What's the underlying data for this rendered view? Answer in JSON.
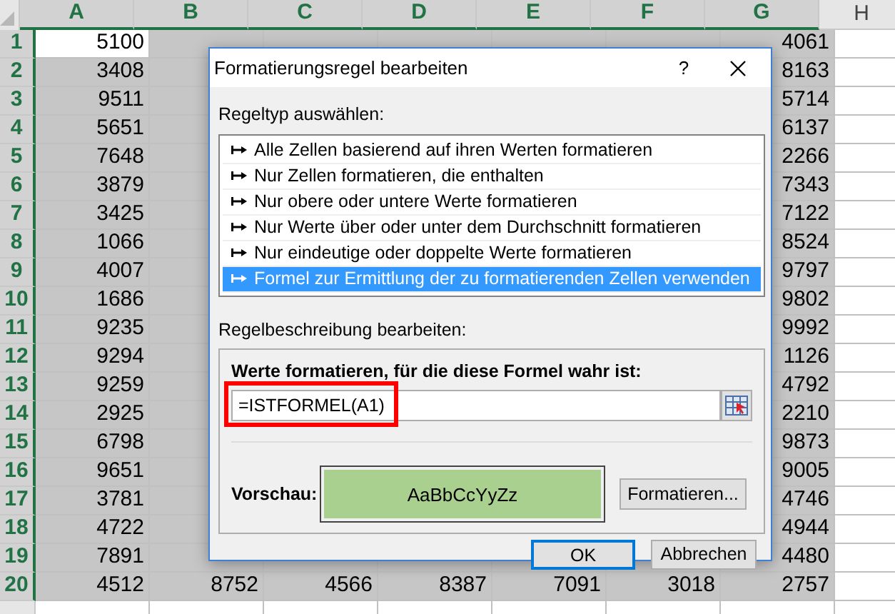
{
  "sheet": {
    "columns": [
      {
        "label": "A",
        "selected": true
      },
      {
        "label": "B",
        "selected": true
      },
      {
        "label": "C",
        "selected": true
      },
      {
        "label": "D",
        "selected": true
      },
      {
        "label": "E",
        "selected": true
      },
      {
        "label": "F",
        "selected": true
      },
      {
        "label": "G",
        "selected": true
      },
      {
        "label": "H",
        "selected": false
      }
    ],
    "rows": [
      {
        "header": "1",
        "selected": true,
        "cells": [
          "5100",
          null,
          null,
          null,
          null,
          null,
          "4061"
        ]
      },
      {
        "header": "2",
        "selected": true,
        "cells": [
          "3408",
          null,
          null,
          null,
          null,
          null,
          "8163"
        ]
      },
      {
        "header": "3",
        "selected": true,
        "cells": [
          "9511",
          null,
          null,
          null,
          null,
          null,
          "5714"
        ]
      },
      {
        "header": "4",
        "selected": true,
        "cells": [
          "5651",
          null,
          null,
          null,
          null,
          null,
          "6137"
        ]
      },
      {
        "header": "5",
        "selected": true,
        "cells": [
          "7648",
          null,
          null,
          null,
          null,
          null,
          "2266"
        ]
      },
      {
        "header": "6",
        "selected": true,
        "cells": [
          "3879",
          null,
          null,
          null,
          null,
          null,
          "7343"
        ]
      },
      {
        "header": "7",
        "selected": true,
        "cells": [
          "3425",
          null,
          null,
          null,
          null,
          null,
          "7122"
        ]
      },
      {
        "header": "8",
        "selected": true,
        "cells": [
          "1066",
          null,
          null,
          null,
          null,
          null,
          "8524"
        ]
      },
      {
        "header": "9",
        "selected": true,
        "cells": [
          "4007",
          null,
          null,
          null,
          null,
          null,
          "9797"
        ]
      },
      {
        "header": "10",
        "selected": true,
        "cells": [
          "1686",
          null,
          null,
          null,
          null,
          null,
          "9802"
        ]
      },
      {
        "header": "11",
        "selected": true,
        "cells": [
          "9235",
          null,
          null,
          null,
          null,
          null,
          "9992"
        ]
      },
      {
        "header": "12",
        "selected": true,
        "cells": [
          "9294",
          null,
          null,
          null,
          null,
          null,
          "1126"
        ]
      },
      {
        "header": "13",
        "selected": true,
        "cells": [
          "9259",
          null,
          null,
          null,
          null,
          null,
          "4792"
        ]
      },
      {
        "header": "14",
        "selected": true,
        "cells": [
          "2925",
          null,
          null,
          null,
          null,
          null,
          "2210"
        ]
      },
      {
        "header": "15",
        "selected": true,
        "cells": [
          "6798",
          null,
          null,
          null,
          null,
          null,
          "9873"
        ]
      },
      {
        "header": "16",
        "selected": true,
        "cells": [
          "9651",
          null,
          null,
          null,
          null,
          null,
          "9005"
        ]
      },
      {
        "header": "17",
        "selected": true,
        "cells": [
          "3781",
          null,
          null,
          null,
          null,
          null,
          "4746"
        ]
      },
      {
        "header": "18",
        "selected": true,
        "cells": [
          "4722",
          null,
          null,
          null,
          null,
          null,
          "4944"
        ]
      },
      {
        "header": "19",
        "selected": true,
        "cells": [
          "7891",
          null,
          null,
          null,
          null,
          null,
          "4480"
        ]
      },
      {
        "header": "20",
        "selected": true,
        "cells": [
          "4512",
          "8752",
          "4566",
          "8387",
          "7091",
          "3018",
          "2757"
        ]
      },
      {
        "header": null,
        "selected": false,
        "cells": [
          null,
          null,
          null,
          null,
          null,
          null,
          null
        ]
      }
    ]
  },
  "dialog": {
    "title": "Formatierungsregel bearbeiten",
    "help": "?",
    "rule_type_label": "Regeltyp auswählen:",
    "rule_types": [
      {
        "label": "Alle Zellen basierend auf ihren Werten formatieren",
        "selected": false
      },
      {
        "label": "Nur Zellen formatieren, die enthalten",
        "selected": false
      },
      {
        "label": "Nur obere oder untere Werte formatieren",
        "selected": false
      },
      {
        "label": "Nur Werte über oder unter dem Durchschnitt formatieren",
        "selected": false
      },
      {
        "label": "Nur eindeutige oder doppelte Werte formatieren",
        "selected": false
      },
      {
        "label": "Formel zur Ermittlung der zu formatierenden Zellen verwenden",
        "selected": true
      }
    ],
    "description_label": "Regelbeschreibung bearbeiten:",
    "formula_label": "Werte formatieren, für die diese Formel wahr ist:",
    "formula": "=ISTFORMEL(A1)",
    "preview_label": "Vorschau:",
    "preview_text": "AaBbCcYyZz",
    "format_button": "Formatieren...",
    "ok_button": "OK",
    "cancel_button": "Abbrechen"
  }
}
